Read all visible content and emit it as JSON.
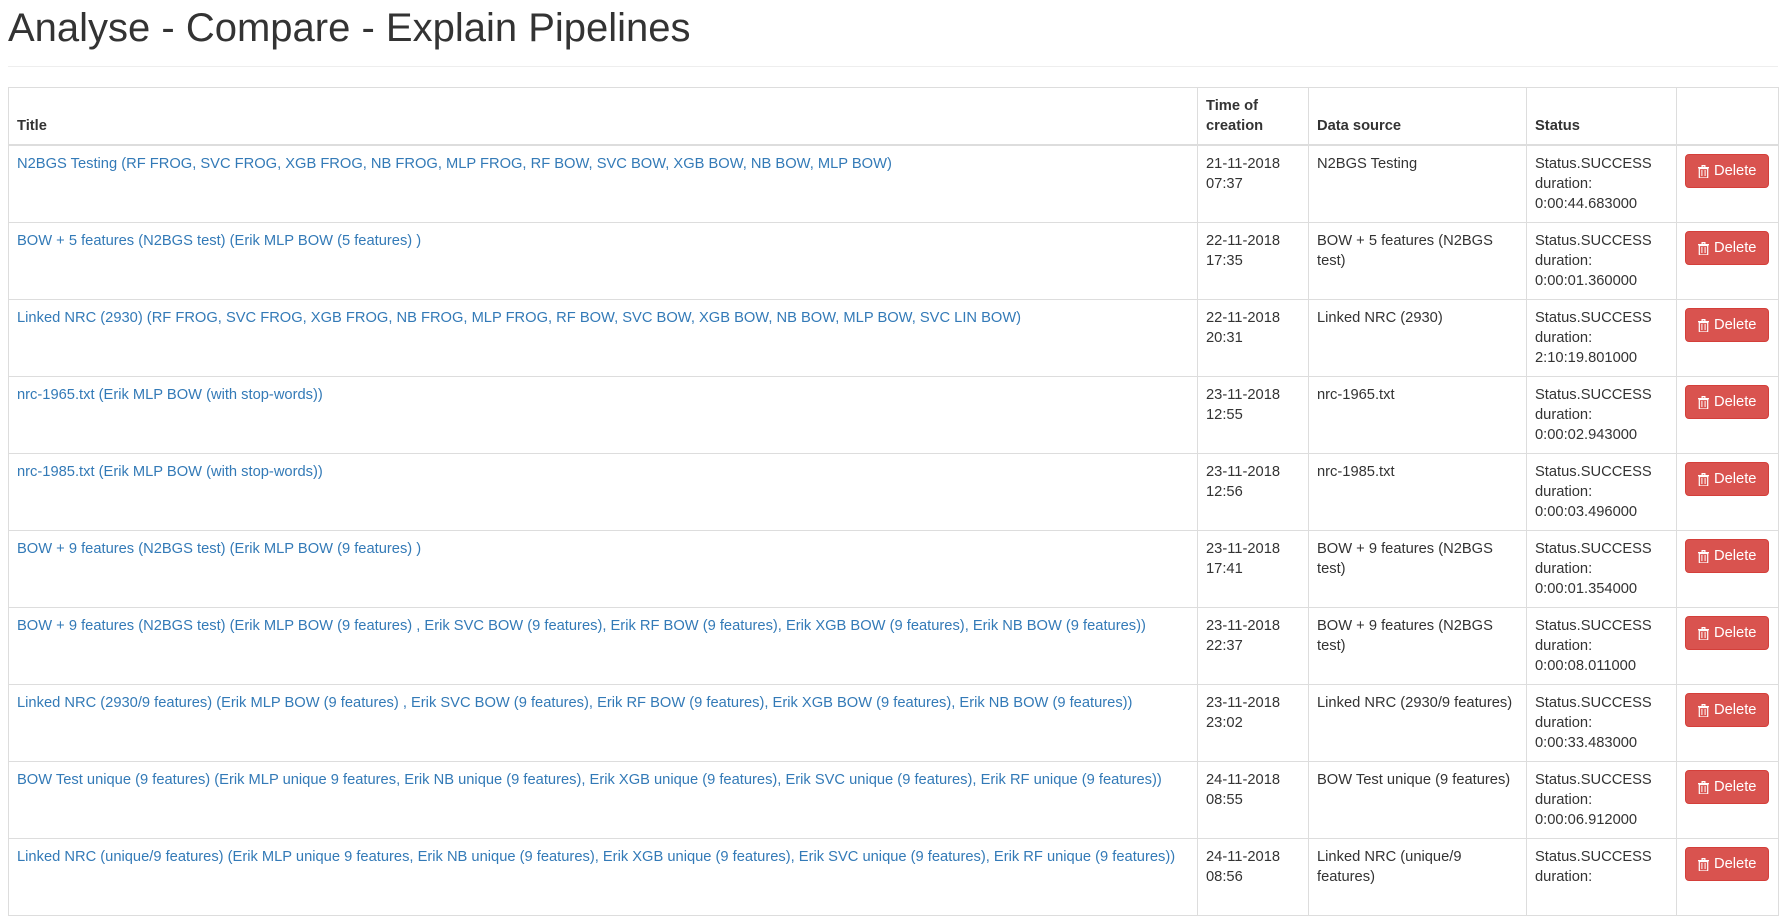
{
  "page": {
    "title": "Analyse - Compare - Explain Pipelines"
  },
  "table": {
    "headers": {
      "title": "Title",
      "time": "Time of creation",
      "source": "Data source",
      "status": "Status",
      "actions": ""
    },
    "delete_label": "Delete",
    "rows": [
      {
        "title": "N2BGS Testing (RF FROG, SVC FROG, XGB FROG, NB FROG, MLP FROG, RF BOW, SVC BOW, XGB BOW, NB BOW, MLP BOW)",
        "date": "21-11-2018",
        "time": "07:37",
        "source": "N2BGS Testing",
        "status": "Status.SUCCESS",
        "duration_label": "duration:",
        "duration": "0:00:44.683000"
      },
      {
        "title": "BOW + 5 features (N2BGS test) (Erik MLP BOW (5 features) )",
        "date": "22-11-2018",
        "time": "17:35",
        "source": "BOW + 5 features (N2BGS test)",
        "status": "Status.SUCCESS",
        "duration_label": "duration:",
        "duration": "0:00:01.360000"
      },
      {
        "title": "Linked NRC (2930) (RF FROG, SVC FROG, XGB FROG, NB FROG, MLP FROG, RF BOW, SVC BOW, XGB BOW, NB BOW, MLP BOW, SVC LIN BOW)",
        "date": "22-11-2018",
        "time": "20:31",
        "source": "Linked NRC (2930)",
        "status": "Status.SUCCESS",
        "duration_label": "duration:",
        "duration": "2:10:19.801000"
      },
      {
        "title": "nrc-1965.txt (Erik MLP BOW (with stop-words))",
        "date": "23-11-2018",
        "time": "12:55",
        "source": "nrc-1965.txt",
        "status": "Status.SUCCESS",
        "duration_label": "duration:",
        "duration": "0:00:02.943000"
      },
      {
        "title": "nrc-1985.txt (Erik MLP BOW (with stop-words))",
        "date": "23-11-2018",
        "time": "12:56",
        "source": "nrc-1985.txt",
        "status": "Status.SUCCESS",
        "duration_label": "duration:",
        "duration": "0:00:03.496000"
      },
      {
        "title": "BOW + 9 features (N2BGS test) (Erik MLP BOW (9 features) )",
        "date": "23-11-2018",
        "time": "17:41",
        "source": "BOW + 9 features (N2BGS test)",
        "status": "Status.SUCCESS",
        "duration_label": "duration:",
        "duration": "0:00:01.354000"
      },
      {
        "title": "BOW + 9 features (N2BGS test) (Erik MLP BOW (9 features) , Erik SVC BOW (9 features), Erik RF BOW (9 features), Erik XGB BOW (9 features), Erik NB BOW (9 features))",
        "date": "23-11-2018",
        "time": "22:37",
        "source": "BOW + 9 features (N2BGS test)",
        "status": "Status.SUCCESS",
        "duration_label": "duration:",
        "duration": "0:00:08.011000"
      },
      {
        "title": "Linked NRC (2930/9 features) (Erik MLP BOW (9 features) , Erik SVC BOW (9 features), Erik RF BOW (9 features), Erik XGB BOW (9 features), Erik NB BOW (9 features))",
        "date": "23-11-2018",
        "time": "23:02",
        "source": "Linked NRC (2930/9 features)",
        "status": "Status.SUCCESS",
        "duration_label": "duration:",
        "duration": "0:00:33.483000"
      },
      {
        "title": "BOW Test unique (9 features) (Erik MLP unique 9 features, Erik NB unique (9 features), Erik XGB unique (9 features), Erik SVC unique (9 features), Erik RF unique (9 features))",
        "date": "24-11-2018",
        "time": "08:55",
        "source": "BOW Test unique (9 features)",
        "status": "Status.SUCCESS",
        "duration_label": "duration:",
        "duration": "0:00:06.912000"
      },
      {
        "title": "Linked NRC (unique/9 features) (Erik MLP unique 9 features, Erik NB unique (9 features), Erik XGB unique (9 features), Erik SVC unique (9 features), Erik RF unique (9 features))",
        "date": "24-11-2018",
        "time": "08:56",
        "source": "Linked NRC (unique/9 features)",
        "status": "Status.SUCCESS",
        "duration_label": "duration:",
        "duration": ""
      }
    ]
  },
  "icons": {
    "delete": "trash-icon"
  },
  "colors": {
    "link": "#337ab7",
    "danger": "#d9534f",
    "border": "#dddddd",
    "text": "#333333"
  }
}
